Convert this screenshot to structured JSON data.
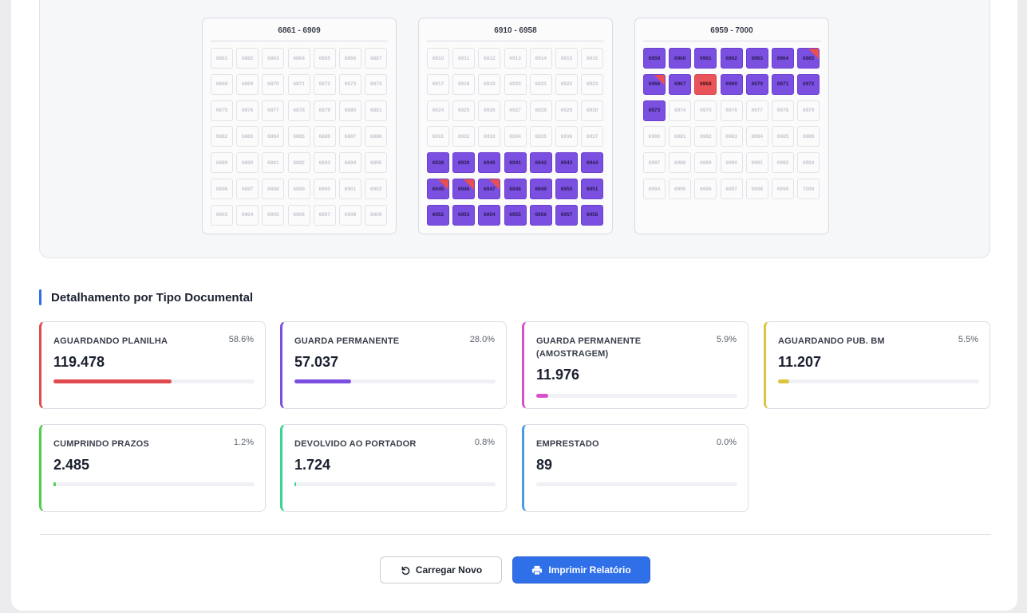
{
  "blocks": [
    {
      "title": "6861 - 6909",
      "start": 6861,
      "end": 6909,
      "filled": [],
      "red": [],
      "corner": []
    },
    {
      "title": "6910 - 6958",
      "start": 6910,
      "end": 6958,
      "filled": [
        6938,
        6939,
        6940,
        6941,
        6942,
        6943,
        6944,
        6945,
        6946,
        6947,
        6948,
        6949,
        6950,
        6951,
        6952,
        6953,
        6954,
        6955,
        6956,
        6957,
        6958
      ],
      "red": [],
      "corner": [
        6945,
        6946,
        6947
      ]
    },
    {
      "title": "6959 - 7000",
      "start": 6959,
      "end": 7000,
      "filled": [
        6959,
        6960,
        6961,
        6962,
        6963,
        6964,
        6965,
        6966,
        6967,
        6969,
        6970,
        6971,
        6972,
        6973
      ],
      "red": [
        6968
      ],
      "corner": [
        6965,
        6966
      ]
    }
  ],
  "colors": {
    "filled": "#7b4fe0",
    "red": "#e8545a",
    "accent": "#2f6fe8"
  },
  "section": {
    "title": "Detalhamento por Tipo Documental"
  },
  "stats": [
    {
      "label": "AGUARDANDO PLANILHA",
      "percent": "58.6%",
      "value": "119.478",
      "fill": 0.586,
      "color": "#e04b4f"
    },
    {
      "label": "GUARDA PERMANENTE",
      "percent": "28.0%",
      "value": "57.037",
      "fill": 0.28,
      "color": "#7b4fe0"
    },
    {
      "label": "GUARDA PERMANENTE (AMOSTRAGEM)",
      "percent": "5.9%",
      "value": "11.976",
      "fill": 0.059,
      "color": "#d84fc8"
    },
    {
      "label": "AGUARDANDO PUB. BM",
      "percent": "5.5%",
      "value": "11.207",
      "fill": 0.055,
      "color": "#dcc43c"
    },
    {
      "label": "CUMPRINDO PRAZOS",
      "percent": "1.2%",
      "value": "2.485",
      "fill": 0.012,
      "color": "#4fd04a"
    },
    {
      "label": "DEVOLVIDO AO PORTADOR",
      "percent": "0.8%",
      "value": "1.724",
      "fill": 0.008,
      "color": "#3fd48c"
    },
    {
      "label": "EMPRESTADO",
      "percent": "0.0%",
      "value": "89",
      "fill": 0.0,
      "color": "#4a9be0"
    }
  ],
  "buttons": {
    "reload": {
      "label": "Carregar Novo",
      "icon": "undo-icon"
    },
    "print": {
      "label": "Imprimir Relatório",
      "icon": "printer-icon"
    }
  }
}
